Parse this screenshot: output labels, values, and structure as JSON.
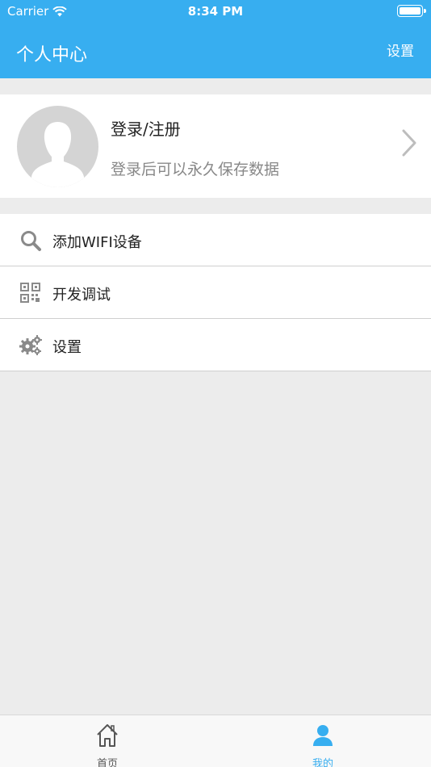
{
  "status_bar": {
    "carrier": "Carrier",
    "time": "8:34 PM"
  },
  "nav": {
    "title": "个人中心",
    "settings_label": "设置"
  },
  "profile": {
    "login_label": "登录/注册",
    "subtitle": "登录后可以永久保存数据"
  },
  "menu": {
    "items": [
      {
        "label": "添加WIFI设备",
        "icon": "search-icon"
      },
      {
        "label": "开发调试",
        "icon": "qr-code-icon"
      },
      {
        "label": "设置",
        "icon": "gears-icon"
      }
    ]
  },
  "tabbar": {
    "tabs": [
      {
        "label": "首页",
        "icon": "home-icon",
        "active": false
      },
      {
        "label": "我的",
        "icon": "user-icon",
        "active": true
      }
    ]
  },
  "colors": {
    "accent": "#37aef0",
    "background": "#ececec",
    "avatar_bg": "#d4d4d4"
  }
}
